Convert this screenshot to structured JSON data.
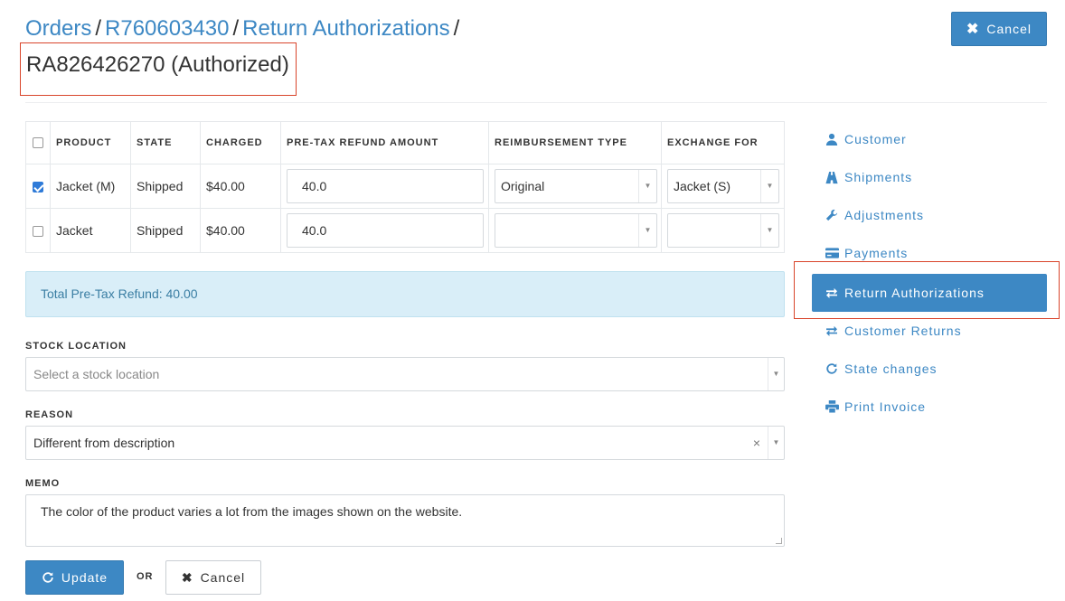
{
  "breadcrumb": {
    "orders": "Orders",
    "order_number": "R760603430",
    "return_authorizations": "Return Authorizations",
    "separator": "/"
  },
  "page_title": "RA826426270 (Authorized)",
  "top_cancel_label": "Cancel",
  "table": {
    "headers": [
      "PRODUCT",
      "STATE",
      "CHARGED",
      "PRE-TAX REFUND AMOUNT",
      "REIMBURSEMENT TYPE",
      "EXCHANGE FOR"
    ],
    "rows": [
      {
        "checked": true,
        "product": "Jacket (M)",
        "state": "Shipped",
        "charged": "$40.00",
        "refund": "40.0",
        "reimbursement": "Original",
        "exchange": "Jacket (S)"
      },
      {
        "checked": false,
        "product": "Jacket",
        "state": "Shipped",
        "charged": "$40.00",
        "refund": "40.0",
        "reimbursement": "",
        "exchange": ""
      }
    ]
  },
  "total_refund": "Total Pre-Tax Refund: 40.00",
  "stock_location": {
    "label": "STOCK LOCATION",
    "placeholder": "Select a stock location"
  },
  "reason": {
    "label": "REASON",
    "value": "Different from description"
  },
  "memo": {
    "label": "MEMO",
    "value": "The color of the product varies a lot from the images shown on the website."
  },
  "actions": {
    "update": "Update",
    "or": "OR",
    "cancel": "Cancel"
  },
  "sidebar": {
    "items": [
      {
        "label": "Customer",
        "icon": "user-icon"
      },
      {
        "label": "Shipments",
        "icon": "road-icon"
      },
      {
        "label": "Adjustments",
        "icon": "wrench-icon"
      },
      {
        "label": "Payments",
        "icon": "credit-card-icon"
      },
      {
        "label": "Return Authorizations",
        "icon": "transfer-icon",
        "active": true
      },
      {
        "label": "Customer Returns",
        "icon": "transfer-icon"
      },
      {
        "label": "State changes",
        "icon": "refresh-icon"
      },
      {
        "label": "Print Invoice",
        "icon": "print-icon"
      }
    ]
  },
  "colors": {
    "accent": "#3d88c4",
    "highlight_border": "#d9452b",
    "info_bg": "#d9eef8"
  }
}
